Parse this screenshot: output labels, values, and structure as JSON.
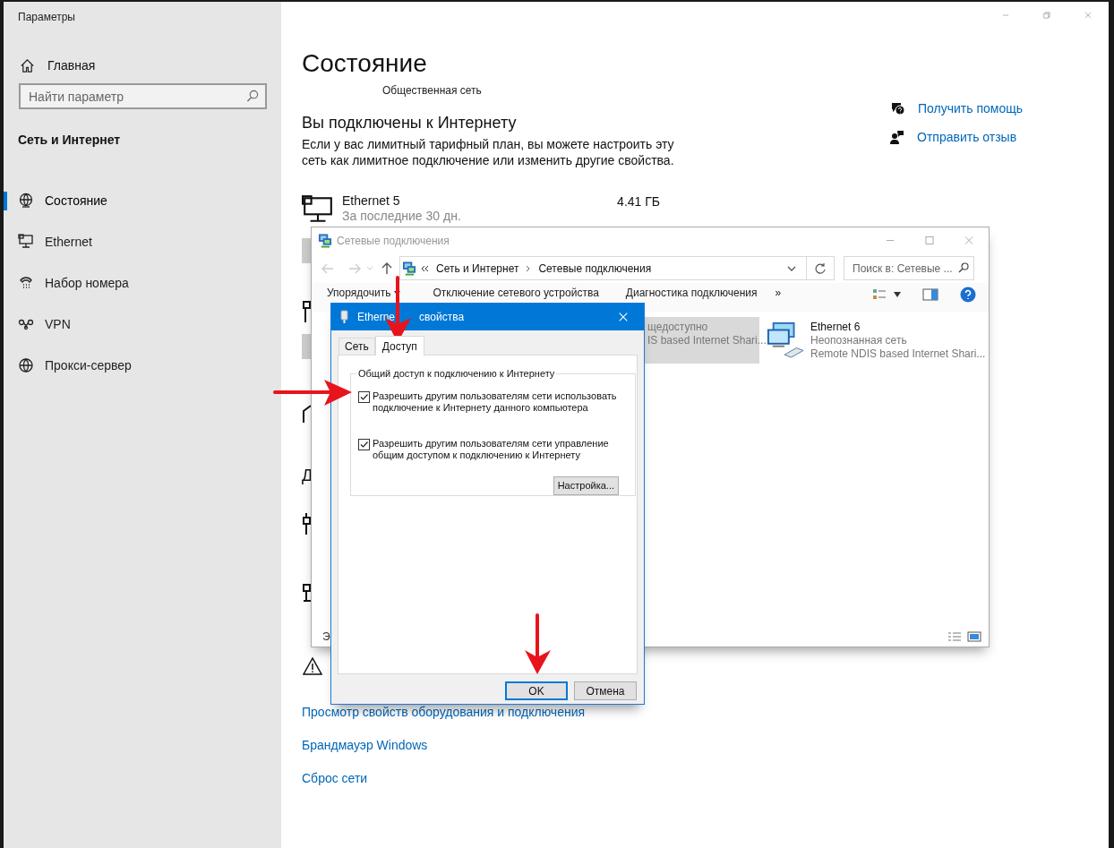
{
  "settings_window": {
    "title": "Параметры",
    "home": "Главная",
    "search": {
      "placeholder": "Найти параметр"
    },
    "section_title": "Сеть и Интернет",
    "nav": [
      {
        "label": "Состояние",
        "selected": true,
        "kind": "status"
      },
      {
        "label": "Ethernet",
        "selected": false,
        "kind": "ethernet"
      },
      {
        "label": "Набор номера",
        "selected": false,
        "kind": "dialup"
      },
      {
        "label": "VPN",
        "selected": false,
        "kind": "vpn"
      },
      {
        "label": "Прокси-сервер",
        "selected": false,
        "kind": "proxy"
      }
    ],
    "page_title": "Состояние",
    "network_profile": "Общественная сеть",
    "heading": "Вы подключены к Интернету",
    "description": "Если у вас лимитный тарифный план, вы можете настроить эту сеть как лимитное подключение или изменить другие свойства.",
    "adapter": {
      "name": "Ethernet 5",
      "period": "За последние 30 дн.",
      "usage": "4.41 ГБ"
    },
    "partial_heading": "Д",
    "links": [
      "Просмотр свойств оборудования и подключения",
      "Брандмауэр Windows",
      "Сброс сети"
    ],
    "help_links": [
      {
        "label": "Получить помощь",
        "kind": "help"
      },
      {
        "label": "Отправить отзыв",
        "kind": "feedback"
      }
    ]
  },
  "explorer_window": {
    "title": "Сетевые подключения",
    "breadcrumb": [
      "Сеть и Интернет",
      "Сетевые подключения"
    ],
    "search": {
      "placeholder": "Поиск в: Сетевые ..."
    },
    "toolbar": [
      "Упорядочить",
      "Отключение сетевого устройства",
      "Диагностика подключения",
      "»"
    ],
    "items": [
      {
        "status": "щедоступно",
        "device": "IS based Internet Shari...",
        "selected": true
      },
      {
        "name": "Ethernet 6",
        "status": "Неопознанная сеть",
        "device": "Remote NDIS based Internet Shari...",
        "selected": false
      }
    ],
    "status_text": "Э"
  },
  "dialog": {
    "title_parts": [
      "Etherne",
      "свойства"
    ],
    "tabs": [
      {
        "label": "Сеть",
        "selected": false
      },
      {
        "label": "Доступ",
        "selected": true
      }
    ],
    "group_label": "Общий доступ к подключению к Интернету",
    "options": [
      {
        "label": "Разрешить другим пользователям сети использовать подключение к Интернету данного компьютера",
        "checked": true
      },
      {
        "label": "Разрешить другим пользователям сети управление общим доступом к подключению к Интернету",
        "checked": true
      }
    ],
    "settings_button": "Настройка...",
    "buttons": [
      {
        "label": "OK",
        "default": true
      },
      {
        "label": "Отмена",
        "default": false
      }
    ]
  }
}
